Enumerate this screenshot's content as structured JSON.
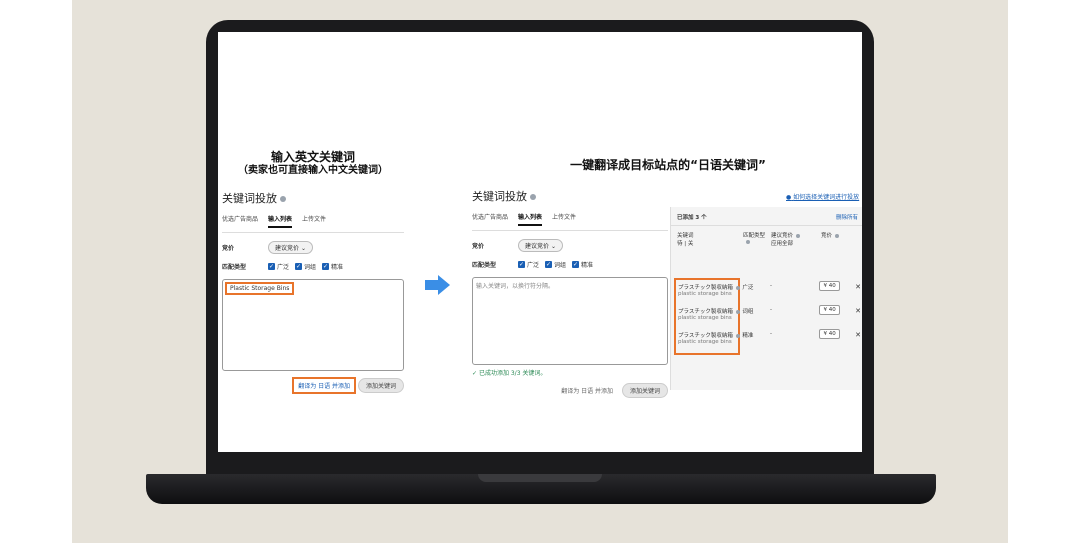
{
  "left": {
    "heading": "输入英文关键词",
    "subheading": "（卖家也可直接输入中文关键词）",
    "title": "关键词投放",
    "tabs": [
      "优选广告商品",
      "输入列表",
      "上传文件"
    ],
    "bid_label": "竞价",
    "bid_value": "建议竞价",
    "match_label": "匹配类型",
    "match_types": [
      "广泛",
      "词组",
      "精准"
    ],
    "textarea_value": "Plastic Storage Bins",
    "translate_button": "翻译为 日语 并添加",
    "add_button": "添加关键词"
  },
  "right": {
    "heading": "一键翻译成目标站点的“日语关键词”",
    "title": "关键词投放",
    "help_link": "如何选择关键词进行投放",
    "tabs": [
      "优选广告商品",
      "输入列表",
      "上传文件"
    ],
    "bid_label": "竞价",
    "bid_value": "建议竞价",
    "match_label": "匹配类型",
    "match_types": [
      "广泛",
      "词组",
      "精准"
    ],
    "placeholder": "输入关键词，以换行符分隔。",
    "success_text": "已成功添加 3/3 关键词。",
    "translate_button": "翻译为 日语 并添加",
    "add_button": "添加关键词",
    "added_label": "已添加 3 个",
    "delete_all": "删除所有",
    "col_keyword": "关键词",
    "col_keyword_sub": "待 | 关",
    "col_match": "匹配类型",
    "col_suggested": "建议竞价",
    "col_suggested_sub": "应用全部",
    "col_bid": "竞价",
    "keywords": [
      {
        "jp": "プラスチック製収納箱",
        "en": "plastic storage bins",
        "match": "广泛",
        "suggested": "-",
        "bid": "40"
      },
      {
        "jp": "プラスチック製収納箱",
        "en": "plastic storage bins",
        "match": "词组",
        "suggested": "-",
        "bid": "40"
      },
      {
        "jp": "プラスチック製収納箱",
        "en": "plastic storage bins",
        "match": "精准",
        "suggested": "-",
        "bid": "40"
      }
    ],
    "currency": "¥"
  },
  "colors": {
    "accent": "#1a5fb4",
    "highlight": "#e8742b",
    "arrow": "#3a8ee6",
    "background": "#e6e2d9"
  }
}
